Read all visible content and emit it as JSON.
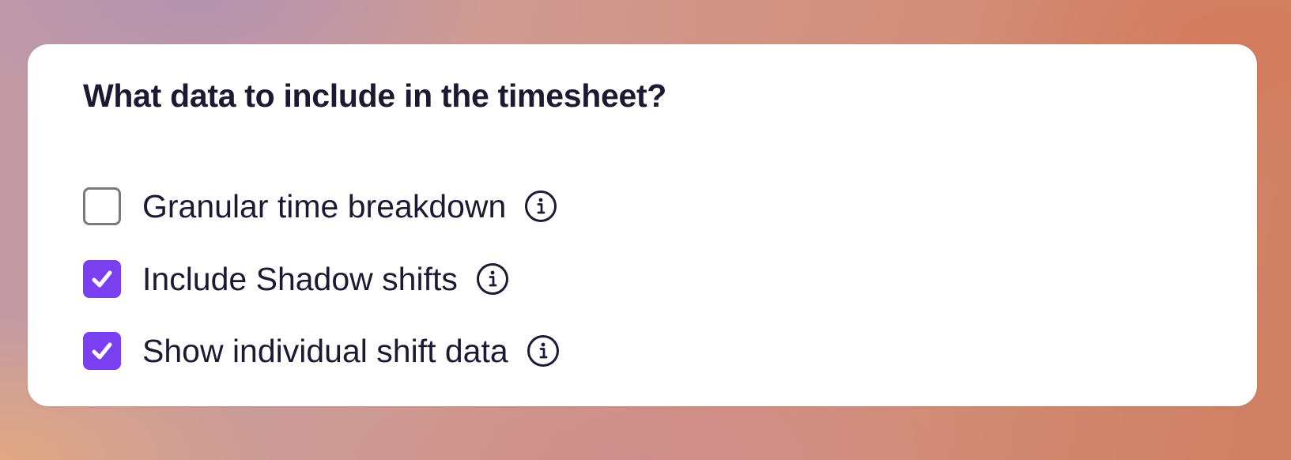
{
  "section": {
    "title": "What data to include in the timesheet?"
  },
  "options": [
    {
      "label": "Granular time breakdown",
      "checked": false,
      "icon": "info-icon"
    },
    {
      "label": "Include Shadow shifts",
      "checked": true,
      "icon": "info-icon"
    },
    {
      "label": "Show individual shift data",
      "checked": true,
      "icon": "info-icon"
    }
  ],
  "colors": {
    "accent": "#7a3ff0",
    "text": "#1c1a33",
    "unchecked_border": "#7a7a7a"
  }
}
